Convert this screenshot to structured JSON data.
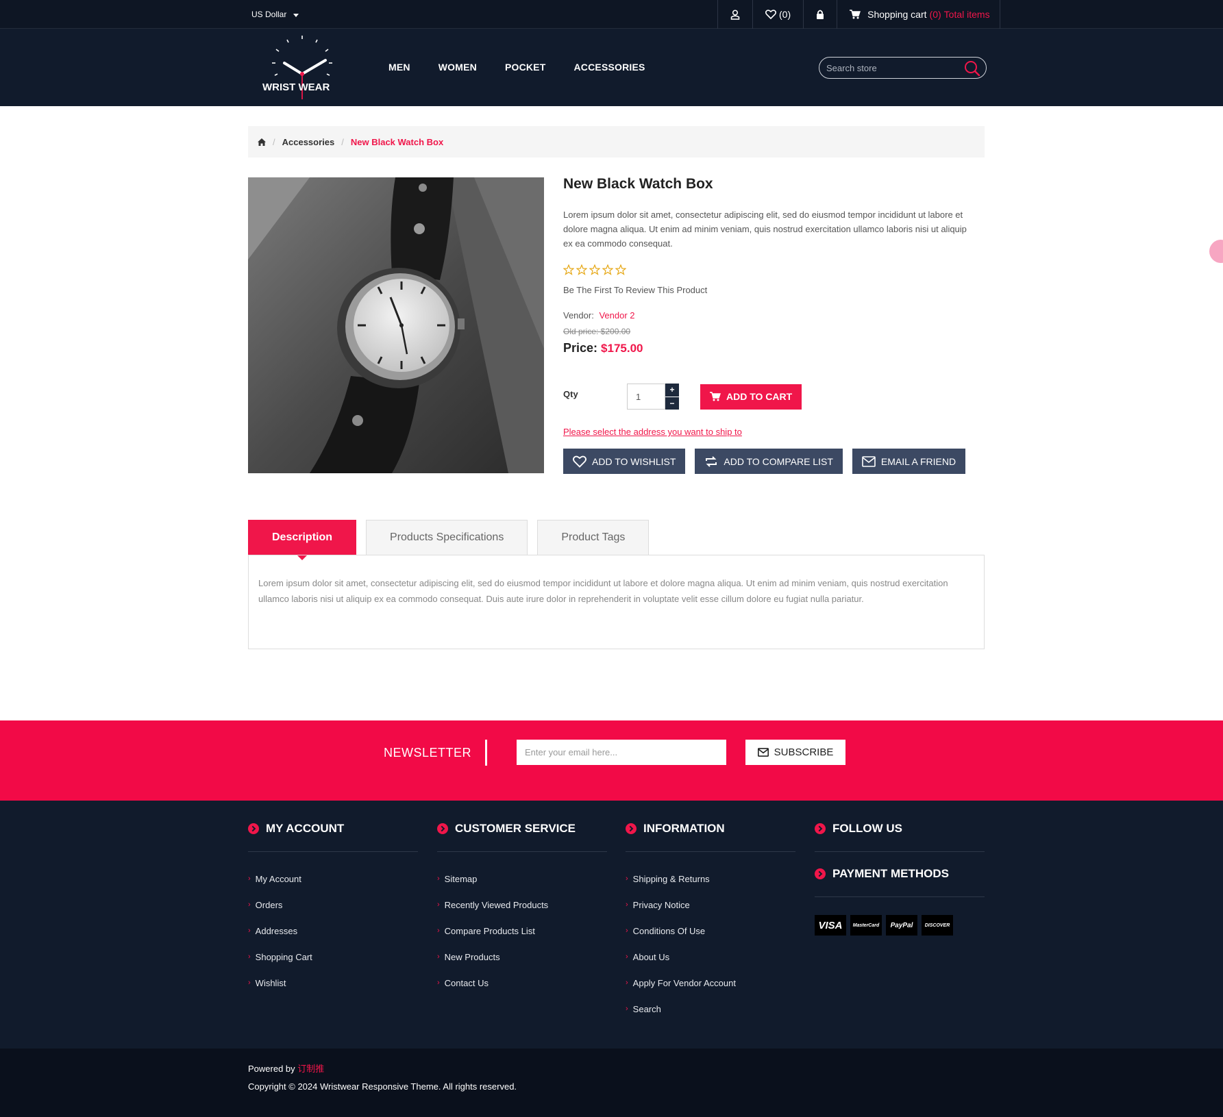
{
  "topbar": {
    "currency": "US Dollar",
    "wishlist_count": "(0)",
    "cart_label": "Shopping cart",
    "cart_count": "(0)",
    "cart_total_label": "Total items"
  },
  "header": {
    "logo_text": "WRIST WEAR",
    "nav": [
      "MEN",
      "WOMEN",
      "POCKET",
      "ACCESSORIES"
    ],
    "search_placeholder": "Search store"
  },
  "breadcrumb": {
    "category": "Accessories",
    "current": "New Black Watch Box"
  },
  "product": {
    "title": "New Black Watch Box",
    "short_description": "Lorem ipsum dolor sit amet, consectetur adipiscing elit, sed do eiusmod tempor incididunt ut labore et dolore magna aliqua. Ut enim ad minim veniam, quis nostrud exercitation ullamco laboris nisi ut aliquip ex ea commodo consequat.",
    "rating": 0,
    "review_prompt": "Be The First To Review This Product",
    "vendor_label": "Vendor:",
    "vendor": "Vendor 2",
    "old_price": "Old price: $200.00",
    "price_label": "Price:",
    "price": "$175.00",
    "qty_label": "Qty",
    "qty_value": "1",
    "add_to_cart": "ADD TO CART",
    "ship_link": "Please select the address you want to ship to",
    "wishlist_btn": "ADD TO WISHLIST",
    "compare_btn": "ADD TO COMPARE LIST",
    "email_btn": "EMAIL A FRIEND"
  },
  "tabs": {
    "items": [
      "Description",
      "Products Specifications",
      "Product Tags"
    ],
    "description": "Lorem ipsum dolor sit amet, consectetur adipiscing elit, sed do eiusmod tempor incididunt ut labore et dolore magna aliqua. Ut enim ad minim veniam, quis nostrud exercitation ullamco laboris nisi ut aliquip ex ea commodo consequat. Duis aute irure dolor in reprehenderit in voluptate velit esse cillum dolore eu fugiat nulla pariatur."
  },
  "newsletter": {
    "title": "NEWSLETTER",
    "placeholder": "Enter your email here...",
    "button": "SUBSCRIBE"
  },
  "footer": {
    "my_account": {
      "title": "MY ACCOUNT",
      "links": [
        "My Account",
        "Orders",
        "Addresses",
        "Shopping Cart",
        "Wishlist"
      ]
    },
    "customer_service": {
      "title": "CUSTOMER SERVICE",
      "links": [
        "Sitemap",
        "Recently Viewed Products",
        "Compare Products List",
        "New Products",
        "Contact Us"
      ]
    },
    "information": {
      "title": "INFORMATION",
      "links": [
        "Shipping & Returns",
        "Privacy Notice",
        "Conditions Of Use",
        "About Us",
        "Apply For Vendor Account",
        "Search"
      ]
    },
    "follow_us": {
      "title": "FOLLOW US"
    },
    "payment": {
      "title": "PAYMENT METHODS",
      "methods": [
        "VISA",
        "MasterCard",
        "PayPal",
        "DISCOVER"
      ]
    },
    "powered_by_label": "Powered by",
    "powered_by": "订制推",
    "copyright": "Copyright © 2024 Wristwear Responsive Theme. All rights reserved."
  },
  "colors": {
    "accent": "#f0164a",
    "dark": "#111b2c",
    "button_dark": "#3c4963"
  }
}
